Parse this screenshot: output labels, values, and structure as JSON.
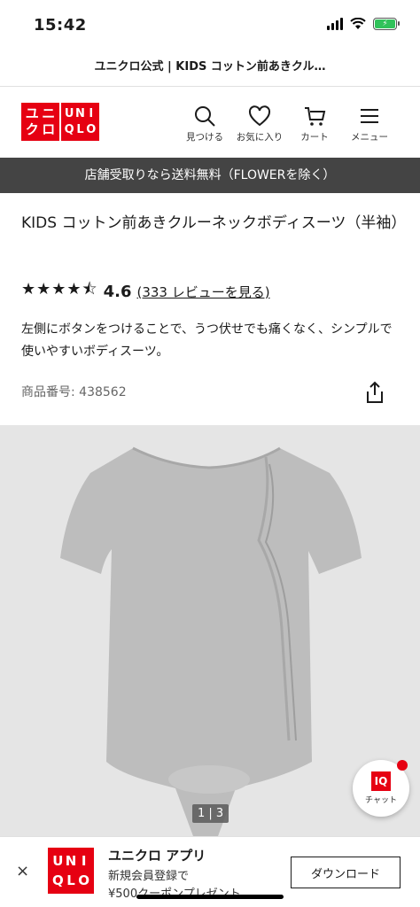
{
  "status": {
    "time": "15:42",
    "battery_icon": "battery-charging-icon"
  },
  "browser": {
    "title": "ユニクロ公式 | KIDS コットン前あきクル…"
  },
  "header": {
    "logo_top": [
      "ユ",
      "ニ",
      "ク",
      "ロ"
    ],
    "logo_right": [
      "U",
      "N",
      "I",
      "Q",
      "L",
      "O"
    ],
    "nav": [
      {
        "label": "見つける",
        "icon": "search-icon"
      },
      {
        "label": "お気に入り",
        "icon": "heart-icon"
      },
      {
        "label": "カート",
        "icon": "cart-icon"
      },
      {
        "label": "メニュー",
        "icon": "menu-icon"
      }
    ]
  },
  "promo": {
    "text": "店舗受取りなら送料無料（FLOWERを除く）"
  },
  "product": {
    "title": "KIDS コットン前あきクルーネックボディスーツ（半袖）",
    "stars": "★★★★⯪",
    "rating": "4.6",
    "rating_value": 4.6,
    "review_link": "(333 レビューを見る)",
    "description": "左側にボタンをつけることで、うつ伏せでも痛くなく、シンプルで使いやすいボディスーツ。",
    "code": "商品番号: 438562"
  },
  "gallery": {
    "indicator": "1 | 3",
    "garment_color": "#bdbdbd"
  },
  "chat": {
    "badge": "IQ",
    "label": "チャット"
  },
  "app_banner": {
    "close": "×",
    "logo_letters": [
      "U",
      "N",
      "I",
      "Q",
      "L",
      "O"
    ],
    "name": "ユニクロ アプリ",
    "desc1": "新規会員登録で",
    "desc2": "¥500クーポンプレゼント",
    "button": "ダウンロード"
  },
  "colors": {
    "brand_red": "#e60012",
    "promo_bg": "#444444"
  }
}
